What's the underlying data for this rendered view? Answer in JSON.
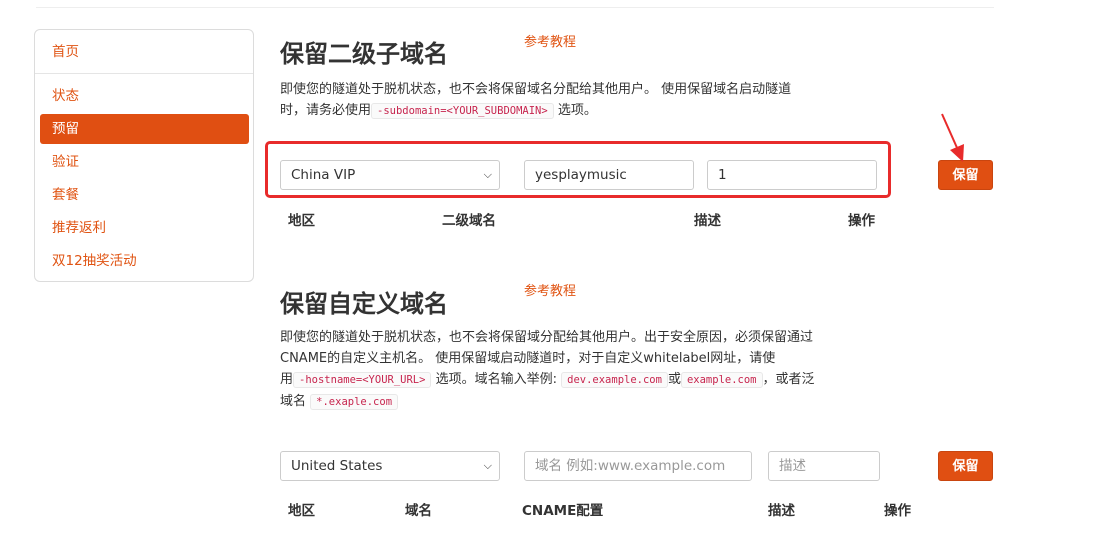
{
  "sidebar": {
    "items": [
      {
        "label": "首页"
      },
      {
        "label": "状态"
      },
      {
        "label": "预留"
      },
      {
        "label": "验证"
      },
      {
        "label": "套餐"
      },
      {
        "label": "推荐返利"
      },
      {
        "label": "双12抽奖活动"
      }
    ]
  },
  "subdomain": {
    "title": "保留二级子域名",
    "ref_link": "参考教程",
    "desc_line1": "即使您的隧道处于脱机状态，也不会将保留域名分配给其他用户。 使用保留域名启动隧道",
    "desc_line2_pre": "时，请务必使用",
    "desc_code": "-subdomain=<YOUR_SUBDOMAIN>",
    "desc_line2_post": "选项。",
    "region_value": "China VIP",
    "subdomain_value": "yesplaymusic",
    "description_value": "1",
    "reserve_button": "保留",
    "headers": {
      "region": "地区",
      "subdomain": "二级域名",
      "description": "描述",
      "action": "操作"
    }
  },
  "custom": {
    "title": "保留自定义域名",
    "ref_link": "参考教程",
    "desc_line1": "即使您的隧道处于脱机状态，也不会将保留域分配给其他用户。出于安全原因，必须保留通过",
    "desc_line2": "CNAME的自定义主机名。 使用保留域启动隧道时，对于自定义whitelabel网址，请使",
    "desc_line3_pre": "用",
    "desc_code1": "-hostname=<YOUR_URL>",
    "desc_line3_mid": "选项。域名输入举例:",
    "desc_code2": "dev.example.com",
    "desc_or": "或",
    "desc_code3": "example.com",
    "desc_line3_post": "，或者泛",
    "desc_line4_pre": "域名",
    "desc_code4": "*.exaple.com",
    "region_value": "United States",
    "domain_placeholder": "域名 例如:www.example.com",
    "description_placeholder": "描述",
    "reserve_button": "保留",
    "headers": {
      "region": "地区",
      "domain": "域名",
      "cname": "CNAME配置",
      "description": "描述",
      "action": "操作"
    }
  },
  "colors": {
    "accent": "#e04f12",
    "highlight": "#e82b2b"
  }
}
